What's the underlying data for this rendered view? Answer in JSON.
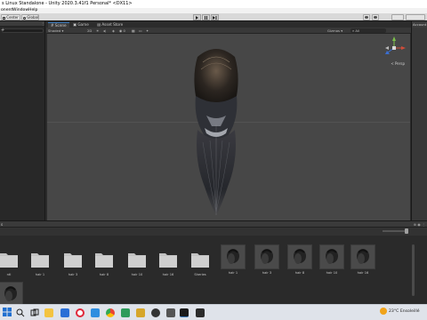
{
  "titlebar": {
    "title": "s Linux Standalone - Unity 2020.3.41f1 Personal* <DX11>"
  },
  "menubar": {
    "items": [
      "onent",
      "Window",
      "Help"
    ]
  },
  "toolbar": {
    "left_buttons": [
      "Center",
      "Global"
    ],
    "play_icons": [
      "play-icon",
      "pause-icon",
      "step-icon"
    ]
  },
  "scene_tabs": [
    {
      "label": "Scene",
      "icon": "grid-icon",
      "active": true
    },
    {
      "label": "Game",
      "icon": "gamepad-icon",
      "active": false
    },
    {
      "label": "Asset Store",
      "icon": "store-icon",
      "active": false
    }
  ],
  "scenebar": {
    "shading": "Shaded",
    "mode_2d": "2D",
    "gizmos": "Gizmos",
    "search_placeholder": "All"
  },
  "viewport": {
    "projection": "< Persp",
    "gizmo_axes": [
      "x",
      "y",
      "z"
    ]
  },
  "inspector": {
    "tab": "Account"
  },
  "project": {
    "header": "s",
    "assets": [
      {
        "label": "ntl",
        "type": "folder"
      },
      {
        "label": "hair 1",
        "type": "folder"
      },
      {
        "label": "hair 3",
        "type": "folder"
      },
      {
        "label": "hair 8",
        "type": "folder"
      },
      {
        "label": "hair 10",
        "type": "folder"
      },
      {
        "label": "hair 16",
        "type": "folder"
      },
      {
        "label": "Sheries",
        "type": "folder"
      },
      {
        "label": "hair 1",
        "type": "hair"
      },
      {
        "label": "hair 3",
        "type": "hair"
      },
      {
        "label": "hair 8",
        "type": "hair"
      },
      {
        "label": "hair 10",
        "type": "hair"
      },
      {
        "label": "hair 16",
        "type": "hair"
      },
      {
        "label": "",
        "type": "hair-partial"
      }
    ]
  },
  "taskbar": {
    "apps": [
      "windows-icon",
      "search-icon",
      "task-view-icon",
      "explorer-icon",
      "mail-icon",
      "opera-icon",
      "vscode-icon",
      "chrome-icon",
      "terminal-icon",
      "steam-icon",
      "unity-icon",
      "unity-hub-icon"
    ],
    "weather": "23°C",
    "weather_desc": "Ensoleillé"
  },
  "colors": {
    "accent": "#3a79bb",
    "viewport_bg": "#474747",
    "panel_bg": "#2a2a2a",
    "weather_sun": "#f0a31a"
  }
}
